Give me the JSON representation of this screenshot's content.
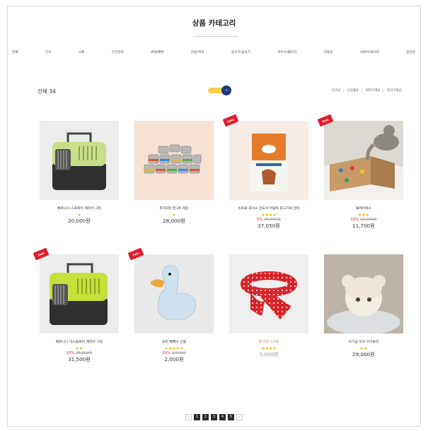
{
  "header": {
    "title": "상품 카테고리"
  },
  "categories": [
    "전체",
    "간식",
    "사료",
    "건강관리",
    "위생/배변",
    "미용/목욕",
    "급수기/급식기",
    "하우스/울타리",
    "이동장",
    "의류/악세사리",
    "장난감"
  ],
  "listing": {
    "total_label": "전체",
    "total_count": "34",
    "toggle_label": "고"
  },
  "sort_options": [
    "인기순",
    "신상품순",
    "최저가격순",
    "최고가격순"
  ],
  "products": [
    {
      "name": "베르니니 스프레이 캐리어 그린",
      "stars": "★",
      "discount_pct": "",
      "original_price": "",
      "price": "20,000원",
      "sale": false,
      "sold_out": false
    },
    {
      "name": "8가지맛 캔 24 개입",
      "stars": "★",
      "discount_pct": "",
      "original_price": "",
      "price": "28,000원",
      "sale": false,
      "sold_out": false
    },
    {
      "name": "뉴트로 초이스 인도어 어덜트 닭고기와 현미",
      "stars": "★★★★",
      "discount_pct": "5%",
      "original_price": "39,000원",
      "price": "37,050원",
      "sale": true,
      "sold_out": false
    },
    {
      "name": "플레이박스",
      "stars": "★★★",
      "discount_pct": "10%",
      "original_price": "13,000원",
      "price": "11,700원",
      "sale": true,
      "sold_out": false
    },
    {
      "name": "베르니니 익스플로러 캐리어 그린",
      "stars": "★★",
      "discount_pct": "10%",
      "original_price": "35,000원",
      "price": "31,500원",
      "sale": true,
      "sold_out": false
    },
    {
      "name": "오리 빽빽이 인형",
      "stars": "★★★★★",
      "discount_pct": "20%",
      "original_price": "2,500원",
      "price": "2,000원",
      "sale": true,
      "sold_out": false
    },
    {
      "name": "펫 리본 스카프",
      "stars": "★★★★",
      "discount_pct": "",
      "original_price": "",
      "price": "5,000원",
      "sale": false,
      "sold_out": true
    },
    {
      "name": "아기곰 모자 아이보리",
      "stars": "★★",
      "discount_pct": "",
      "original_price": "",
      "price": "29,000원",
      "sale": false,
      "sold_out": false
    }
  ],
  "badge": {
    "sale_label": "Sale"
  },
  "pagination": {
    "prev": "‹",
    "pages": [
      "1",
      "2",
      "3",
      "4",
      "5"
    ],
    "next": "›"
  },
  "colors": {
    "sale_red": "#e21b2a",
    "star_gold": "#f0b400",
    "toggle_yellow": "#f3d24b",
    "toggle_navy": "#1f3a7a"
  }
}
